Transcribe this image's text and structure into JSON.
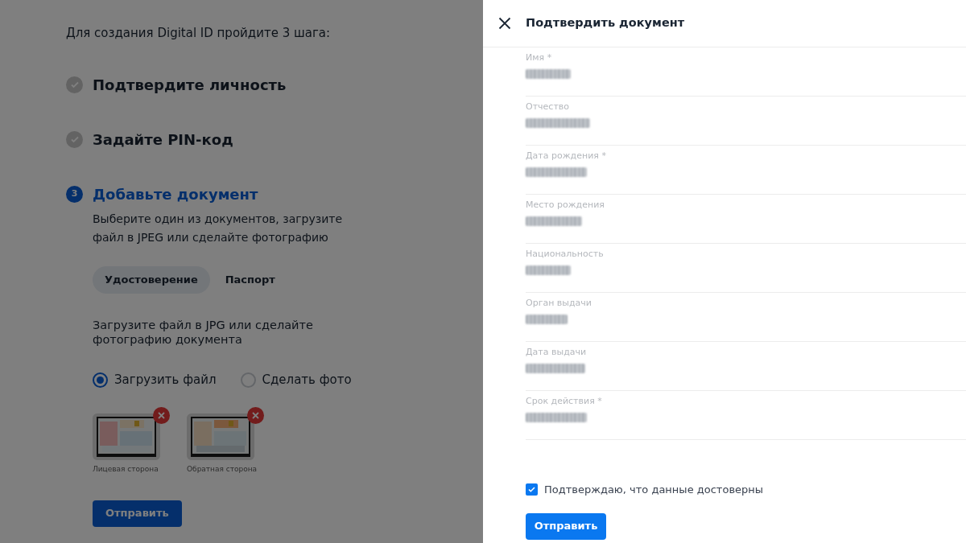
{
  "intro": "Для создания Digital ID пройдите 3 шага:",
  "steps": [
    {
      "kind": "done",
      "title": "Подтвердите личность"
    },
    {
      "kind": "done",
      "title": "Задайте PIN-код"
    },
    {
      "kind": "current",
      "number": "3",
      "title": "Добавьте документ"
    }
  ],
  "step_description": "Выберите один из документов, загрузите файл в JPEG или сделайте фотографию",
  "document_tabs": [
    {
      "label": "Удостоверение",
      "selected": true
    },
    {
      "label": "Паспорт",
      "selected": false
    }
  ],
  "upload_hint": "Загрузите файл в JPG или сделайте фотографию документа",
  "upload_options": [
    {
      "label": "Загрузить файл",
      "selected": true
    },
    {
      "label": "Сделать фото",
      "selected": false
    }
  ],
  "uploads": [
    {
      "caption": "Лицевая сторона"
    },
    {
      "caption": "Обратная сторона"
    }
  ],
  "submit_button": "Отправить",
  "drawer": {
    "title": "Подтвердить документ",
    "fields": [
      {
        "label": "Имя *"
      },
      {
        "label": "Отчество"
      },
      {
        "label": "Дата рождения *"
      },
      {
        "label": "Место рождения"
      },
      {
        "label": "Национальность"
      },
      {
        "label": "Орган выдачи"
      },
      {
        "label": "Дата выдачи"
      },
      {
        "label": "Срок действия *"
      }
    ],
    "confirm": {
      "label": "Подтверждаю, что данные достоверны",
      "checked": true
    },
    "submit_button": "Отправить"
  }
}
